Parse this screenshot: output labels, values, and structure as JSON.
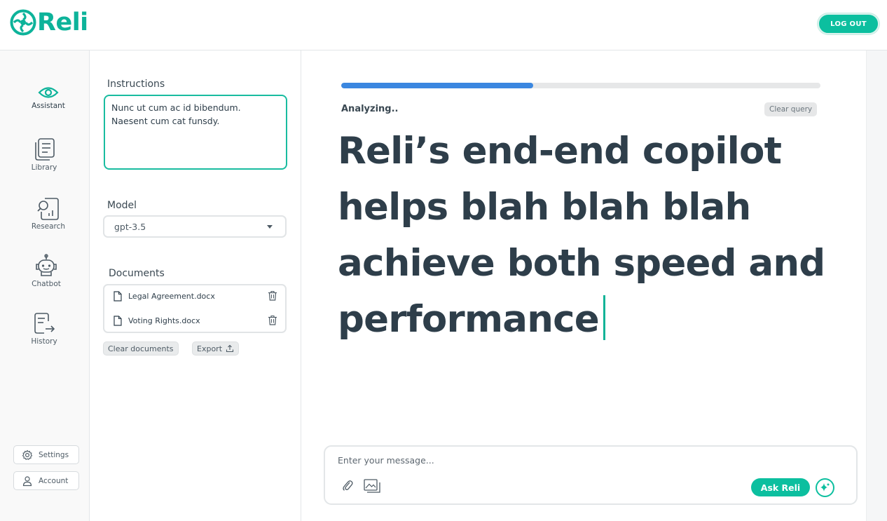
{
  "header": {
    "logo_text": "Reli",
    "logout_label": "LOG OUT"
  },
  "nav": {
    "items": [
      {
        "label": "Assistant",
        "icon": "eye-icon",
        "active": true
      },
      {
        "label": "Library",
        "icon": "library-icon"
      },
      {
        "label": "Research",
        "icon": "research-icon"
      },
      {
        "label": "Chatbot",
        "icon": "robot-icon"
      },
      {
        "label": "History",
        "icon": "history-icon"
      }
    ],
    "settings_label": "Settings",
    "account_label": "Account"
  },
  "panel": {
    "instructions_title": "Instructions",
    "instructions_text": "Nunc ut cum ac id bibendum. Naesent cum cat funsdy.",
    "model_title": "Model",
    "model_value": "gpt-3.5",
    "documents_title": "Documents",
    "documents": [
      {
        "name": "Legal Agreement.docx"
      },
      {
        "name": "Voting Rights.docx"
      }
    ],
    "clear_documents_label": "Clear documents",
    "export_label": "Export"
  },
  "main": {
    "progress": 0.4,
    "status": "Analyzing..",
    "clear_query_label": "Clear query",
    "headline": "Reli’s end-end copilot helps blah blah blah achieve both speed and performance",
    "composer_placeholder": "Enter your message...",
    "ask_label": "Ask Reli"
  },
  "colors": {
    "brand": "#0cbf9f",
    "progress": "#3b87e0",
    "text": "#2e3e4a"
  }
}
